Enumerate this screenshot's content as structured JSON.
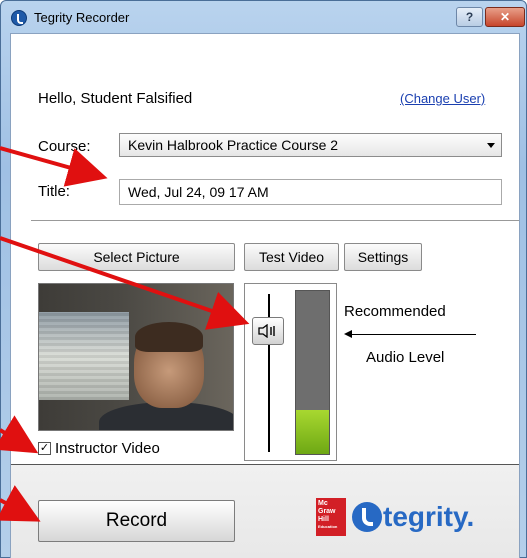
{
  "window": {
    "title": "Tegrity Recorder",
    "help_label": "?",
    "close_label": "✕"
  },
  "greeting": {
    "hello_text": "Hello,  Student Falsified",
    "change_user_link": "(Change User)"
  },
  "course": {
    "label": "Course:",
    "selected": "Kevin Halbrook Practice Course 2"
  },
  "title_field": {
    "label": "Title:",
    "value": "Wed, Jul 24, 09 17 AM"
  },
  "buttons": {
    "select_picture": "Select Picture",
    "test_video": "Test Video",
    "settings": "Settings",
    "record": "Record"
  },
  "audio": {
    "recommended_label": "Recommended",
    "audio_level_label": "Audio Level",
    "meter_level": 0.27
  },
  "instructor_video": {
    "label": "Instructor Video",
    "checked": true
  },
  "branding": {
    "mgh_lines": [
      "Mc",
      "Graw",
      "Hill",
      "Education"
    ],
    "product": "tegrity."
  },
  "colors": {
    "accent_blue": "#2769c4",
    "mgh_red": "#d21f26",
    "meter_green": "#8cc21f",
    "annotation_red": "#e01010"
  }
}
